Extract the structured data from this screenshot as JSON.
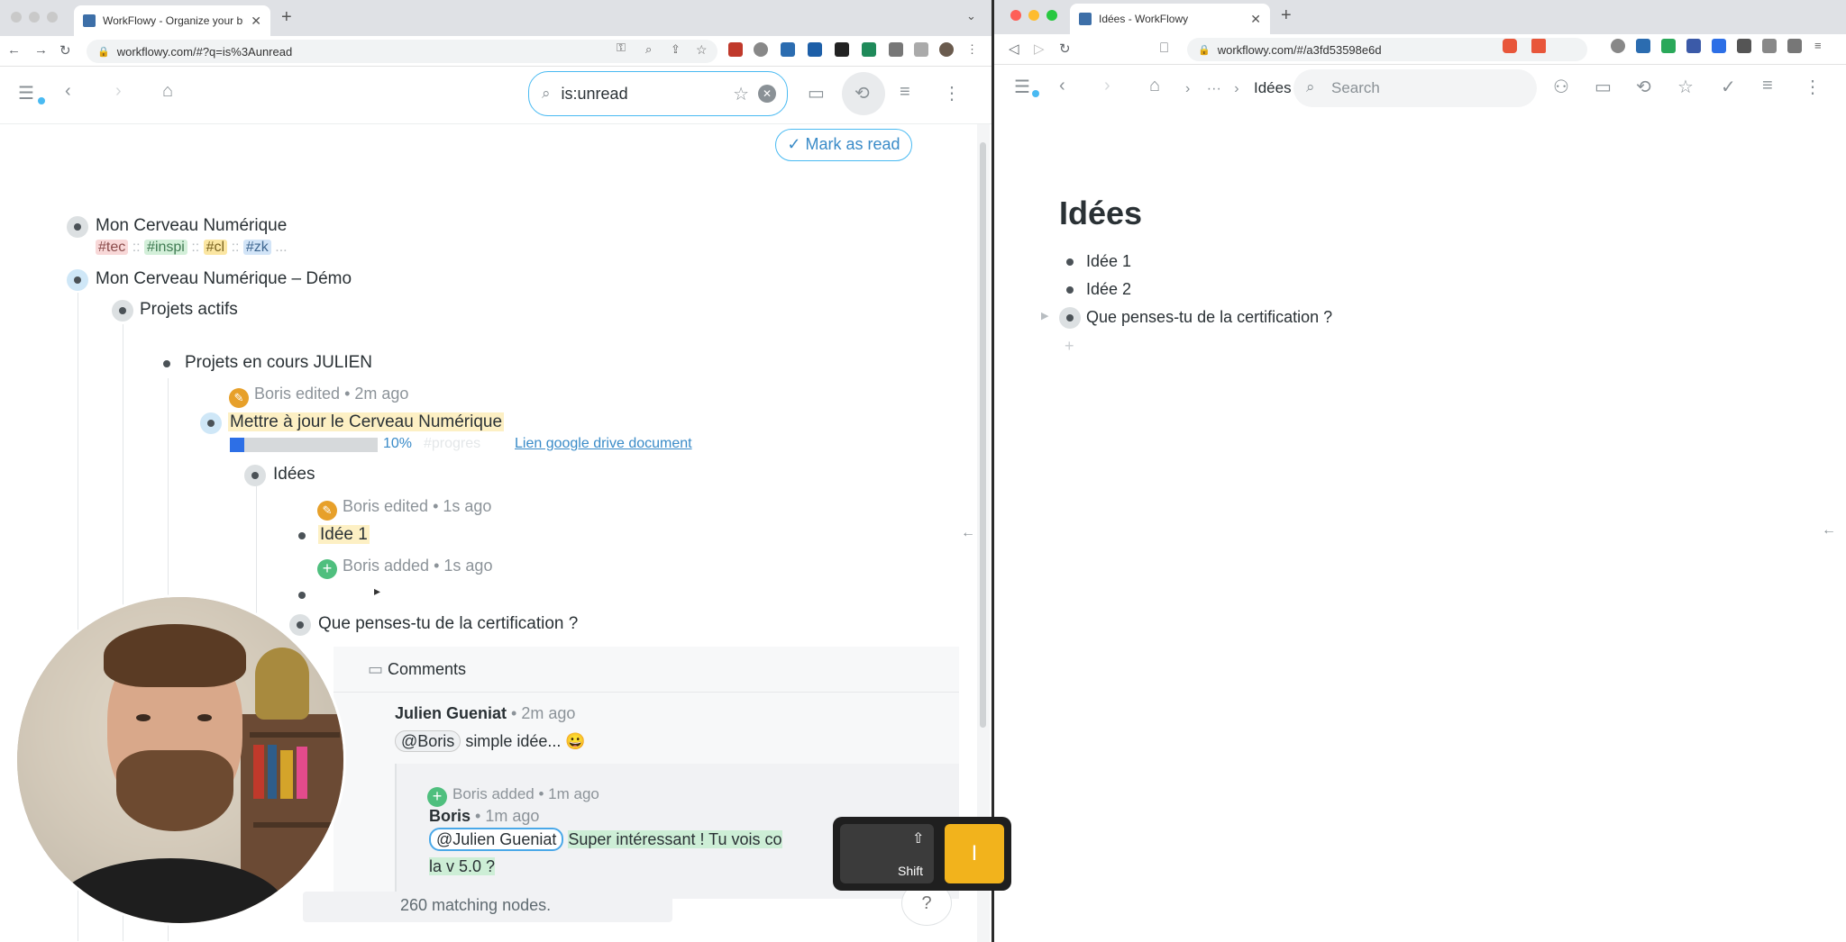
{
  "left_browser": {
    "tab_title": "WorkFlowy - Organize your bra",
    "url": "workflowy.com/#?q=is%3Aunread",
    "search_value": "is:unread",
    "mark_as_read": "Mark as read",
    "matching": "260 matching nodes."
  },
  "right_browser": {
    "tab_title": "Idées - WorkFlowy",
    "url": "workflowy.com/#/a3fd53598e6d",
    "breadcrumb_ellipsis": "···",
    "breadcrumb_current": "Idées",
    "search_placeholder": "Search",
    "page_title": "Idées",
    "items": [
      "Idée 1",
      "Idée 2",
      "Que penses-tu de la certification ?"
    ]
  },
  "outline": {
    "root1": "Mon Cerveau Numérique",
    "tags": [
      "#tec",
      "#inspi",
      "#cl",
      "#zk"
    ],
    "tag_sep": "::",
    "tag_more": "...",
    "root2": "Mon Cerveau Numérique – Démo",
    "projets_actifs": "Projets actifs",
    "projets_julien": "Projets en cours JULIEN",
    "edit1_who": "Boris edited",
    "edit1_when": "2m ago",
    "task": "Mettre à jour le Cerveau Numérique",
    "progress_value": 10,
    "progress_label": "10%",
    "progress_tag": "#progres",
    "drive_link": "Lien google drive document",
    "idees": "Idées",
    "edit2_who": "Boris edited",
    "edit2_when": "1s ago",
    "idee1": "Idée 1",
    "added_who": "Boris added",
    "added_when": "1s ago",
    "question": "Que penses-tu de la certification ?"
  },
  "comments": {
    "header": "Comments",
    "c1_author": "Julien Gueniat",
    "c1_when": "2m ago",
    "c1_mention": "@Boris",
    "c1_text": "simple idée... 😀",
    "c2_added_who": "Boris added",
    "c2_added_when": "1m ago",
    "c2_author": "Boris",
    "c2_when": "1m ago",
    "c2_mention": "@Julien Gueniat",
    "c2_text": "Super intéressant ! Tu vois co",
    "c2_text2": "la v 5.0 ?"
  },
  "keyboard": {
    "shift_label": "Shift",
    "shift_glyph": "⇧",
    "letter": "I"
  },
  "colors": {
    "accent": "#49baf2",
    "highlight": "#fdf0c4",
    "progress": "#2d6fe6",
    "key_yellow": "#f2b31c"
  }
}
